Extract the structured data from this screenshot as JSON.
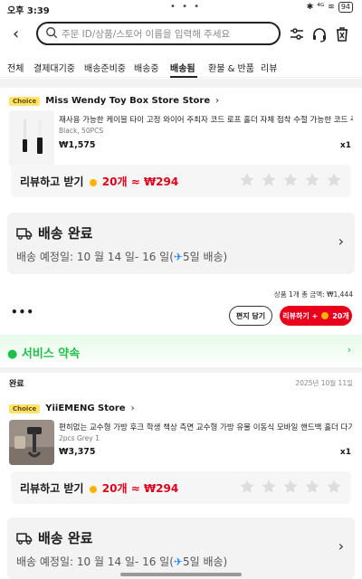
{
  "status_bar": {
    "time": "오후 3:39",
    "center_dots": "• • •",
    "signal": "⁴ᴳ",
    "battery": "94"
  },
  "search": {
    "placeholder": "주문 ID/상품/스토어 이름을 입력해 주세요"
  },
  "tabs": [
    {
      "label": "전체"
    },
    {
      "label": "결제대기중"
    },
    {
      "label": "배송준비중"
    },
    {
      "label": "배송중"
    },
    {
      "label": "배송됨",
      "active": true
    },
    {
      "label": "환불 & 반품"
    },
    {
      "label": "리뷰"
    }
  ],
  "orders": [
    {
      "badge": "Choice",
      "store": "Miss Wendy Toy Box Store Store",
      "product_name": "재사용 가능한 케이블 타이 고정 와이어 주최자 코드 로프 홀더 자체 접착 수절 가능한 코드 주최자 스트랩",
      "variant": "Black, 50PCS",
      "price": "₩1,575",
      "qty": "x1",
      "review_prefix": "리뷰하고 받기",
      "review_reward": "20개 ≈ ₩294",
      "delivery_title": "배송 완료",
      "delivery_sub_prefix": "배송 예정일: 10 월 14 일- 16 일(",
      "delivery_sub_days": "5일",
      "delivery_sub_suffix": " 배송)",
      "total": "상품 1개 총 금액: ₩1,444",
      "more": "•••",
      "edit_label": "편지 담기",
      "review_btn_label": "리뷰하기 +",
      "review_btn_reward": "20개"
    },
    {
      "status": "완료",
      "date": "2025년 10월 11일",
      "badge": "Choice",
      "store": "YiiEMENG Store",
      "product_name": "편히없는 교수형 가방 후크 학생 책상 측면 교수형 가방 유물 이동식 모바일 핸드백 홀더 다기능 테이블",
      "variant": "2pcs Grey 1",
      "price": "₩3,375",
      "qty": "x1",
      "review_prefix": "리뷰하고 받기",
      "review_reward": "20개 ≈ ₩294",
      "delivery_title": "배송 완료",
      "delivery_sub_prefix": "배송 예정일: 10 월 14 일- 16 일(",
      "delivery_sub_days": "5일",
      "delivery_sub_suffix": " 배송)"
    }
  ],
  "service": {
    "label": "서비스 약속",
    "arrow": "›"
  },
  "colors": {
    "accent_red": "#e8001c",
    "service_green": "#1ec04a",
    "choice_yellow": "#fde36a"
  },
  "icons": [
    "back-arrow-icon",
    "search-icon",
    "filter-icon",
    "support-headset-icon",
    "trash-icon",
    "truck-icon",
    "star-icon",
    "chevron-right-icon"
  ]
}
